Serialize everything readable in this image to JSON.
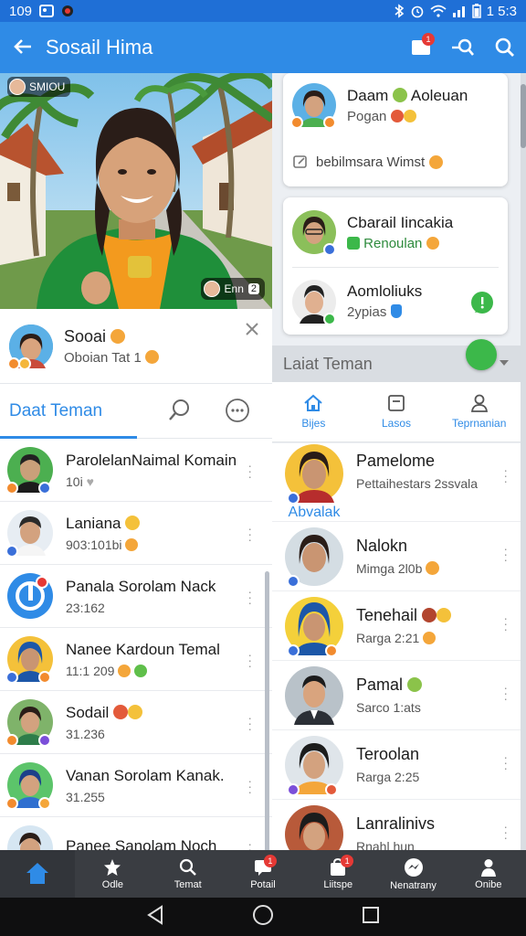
{
  "status_bar": {
    "time_left": "109",
    "time_right": "1 5:3"
  },
  "app_bar": {
    "title": "Sosail Hima",
    "notif_badge": "1"
  },
  "hero": {
    "chip_tl": "SMIOU",
    "chip_br": "Enn",
    "chip_br_num": "2"
  },
  "profile": {
    "name": "Sooai",
    "sub": "Oboian Tat 1"
  },
  "left_tab": {
    "label": "Daat Teman"
  },
  "left_list": [
    {
      "name": "ParolelanNaimal Komain",
      "sub": "10i"
    },
    {
      "name": "Laniana",
      "sub": "903:101bi"
    },
    {
      "name": "Panala Sorolam Nack",
      "sub": "23:162"
    },
    {
      "name": "Nanee Kardoun Temal",
      "sub": "11:1 209"
    },
    {
      "name": "Sodail",
      "sub": "31.236"
    },
    {
      "name": "Vanan Sorolam Kanak.",
      "sub": "31.255"
    },
    {
      "name": "Panee Sanolam Noch",
      "sub": ""
    }
  ],
  "cards": {
    "card1": {
      "name": "Daam",
      "name2": "Aoleuan",
      "sub": "Pogan",
      "note": "bebilmsara Wimst"
    },
    "card2": {
      "name": "Cbarail Iincakia",
      "sub": "Renoulan"
    },
    "card3": {
      "name": "Aomloliuks",
      "sub": "2ypias"
    }
  },
  "section": {
    "label": "Laiat Teman"
  },
  "sub_tabs": [
    {
      "label": "Bijes",
      "icon": "home-icon"
    },
    {
      "label": "Lasos",
      "icon": "box-icon"
    },
    {
      "label": "Teprnanian",
      "icon": "person-icon"
    }
  ],
  "right_list": [
    {
      "name": "Pamelome",
      "sub": "Pettaihestars 2ssvala",
      "tag": "Abvalak"
    },
    {
      "name": "Nalokn",
      "sub": "Mimga 2l0b"
    },
    {
      "name": "Tenehail",
      "sub": "Rarga 2:21"
    },
    {
      "name": "Pamal",
      "sub": "Sarco 1:ats"
    },
    {
      "name": "Teroolan",
      "sub": "Rarga 2:25"
    },
    {
      "name": "Lanralinivs",
      "sub": "Rnahl hun"
    }
  ],
  "bottom_nav": [
    {
      "label": "",
      "icon": "home-icon",
      "badge": ""
    },
    {
      "label": "Odle",
      "icon": "star-icon",
      "badge": ""
    },
    {
      "label": "Temat",
      "icon": "search-icon",
      "badge": ""
    },
    {
      "label": "Potail",
      "icon": "chat-icon",
      "badge": "1"
    },
    {
      "label": "Liitspe",
      "icon": "bag-icon",
      "badge": "1"
    },
    {
      "label": "Nenatrany",
      "icon": "messenger-icon",
      "badge": ""
    },
    {
      "label": "Onibe",
      "icon": "person-icon",
      "badge": ""
    }
  ],
  "colors": {
    "primary": "#2f8be6",
    "status": "#1f6fd6",
    "nav": "#3a3d42",
    "green": "#3cb84a"
  }
}
